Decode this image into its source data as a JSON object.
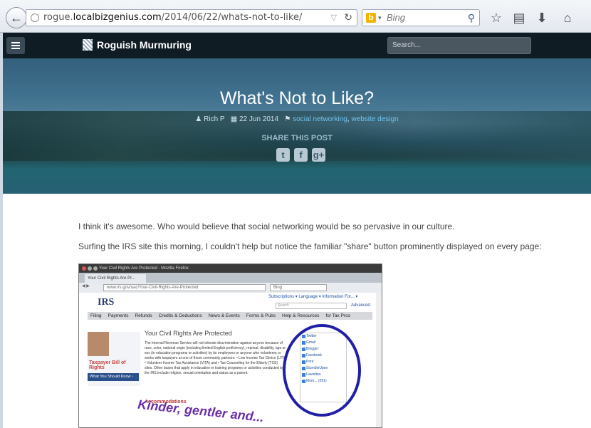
{
  "browser": {
    "url_prefix": "rogue.",
    "url_domain": "localbizgenius.com",
    "url_path": "/2014/06/22/whats-not-to-like/",
    "search_engine": "Bing"
  },
  "site": {
    "brand": "Roguish Murmuring",
    "search_placeholder": "Search..."
  },
  "post": {
    "title": "What's Not to Like?",
    "author": "Rich P",
    "date": "22 Jun 2014",
    "tag1": "social networking",
    "tag2": "website design",
    "share_label": "SHARE THIS POST",
    "para1": "I think it's awesome. Who would believe that social networking would be so pervasive in our culture.",
    "para2": "Surfing the IRS site this morning, I couldn't help but notice the familiar \"share\" button prominently displayed on every page:"
  },
  "embedded": {
    "window_title": "Your Civil Rights Are Protected - Mozilla Firefox",
    "tab": "Your Civil Rights Are Pr...",
    "url": "www.irs.gov/uac/Your-Civil-Rights-Are-Protected",
    "search": "Bing",
    "logo": "IRS",
    "links": "Subscriptions ▾   Language ▾   Information For... ▾",
    "search_box": "Search",
    "advanced": "Advanced",
    "menu": [
      "Filing",
      "Payments",
      "Refunds",
      "Credits & Deductions",
      "News & Events",
      "Forms & Pubs",
      "Help & Resources",
      "for Tax Pros"
    ],
    "heading": "Your Civil Rights Are Protected",
    "body": "The Internal Revenue Service will not tolerate discrimination against anyone because of race, color, national origin (including limited English proficiency), reprisal, disability, age or sex (in education programs or activities) by its employees or anyone who volunteers or works with taxpayers at one of these community partners: • Low Income Tax Clinics (LITC) • Volunteer Income Tax Assistance (VITA) and • Tax Counseling for the Elderly (TCE) sites. Other bases that apply in education or training programs or activities conducted by the IRS include religion, sexual orientation and status as a parent.",
    "sidebar_title": "Taxpayer Bill of Rights",
    "sidebar_btn": "What You Should Know ›",
    "accommodations": "Accommodations",
    "watermark": "Kinder, gentler and...",
    "share_items": [
      "Twitter",
      "Gmail",
      "Blogger",
      "Facebook",
      "Print",
      "StumbleUpon",
      "Favorites",
      "More... (291)"
    ]
  }
}
